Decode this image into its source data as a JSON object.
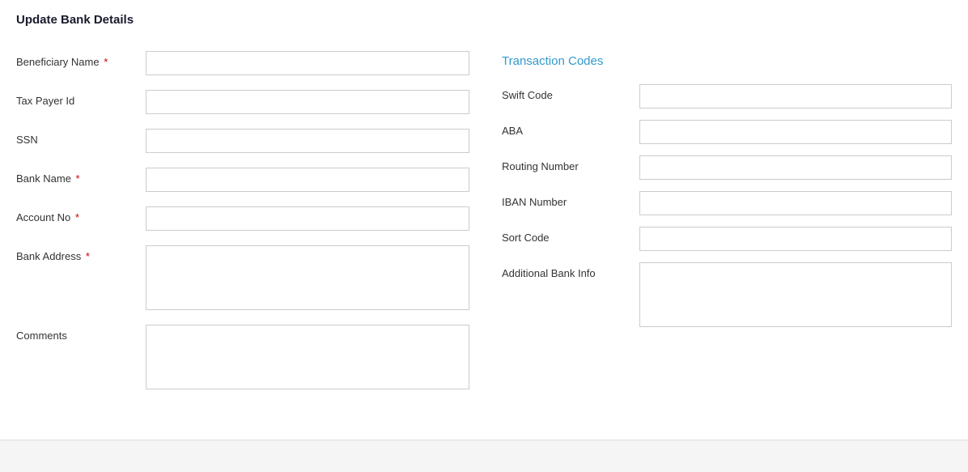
{
  "page": {
    "title": "Update Bank Details"
  },
  "left_form": {
    "fields": [
      {
        "id": "beneficiary-name",
        "label": "Beneficiary Name",
        "required": true,
        "type": "input"
      },
      {
        "id": "tax-payer-id",
        "label": "Tax Payer Id",
        "required": false,
        "type": "input"
      },
      {
        "id": "ssn",
        "label": "SSN",
        "required": false,
        "type": "input"
      },
      {
        "id": "bank-name",
        "label": "Bank Name",
        "required": true,
        "type": "input"
      },
      {
        "id": "account-no",
        "label": "Account No",
        "required": true,
        "type": "input"
      },
      {
        "id": "bank-address",
        "label": "Bank Address",
        "required": true,
        "type": "textarea"
      },
      {
        "id": "comments",
        "label": "Comments",
        "required": false,
        "type": "textarea"
      }
    ]
  },
  "right_section": {
    "title": "Transaction Codes",
    "fields": [
      {
        "id": "swift-code",
        "label": "Swift Code",
        "type": "input"
      },
      {
        "id": "aba",
        "label": "ABA",
        "type": "input"
      },
      {
        "id": "routing-number",
        "label": "Routing Number",
        "type": "input"
      },
      {
        "id": "iban-number",
        "label": "IBAN Number",
        "type": "input"
      },
      {
        "id": "sort-code",
        "label": "Sort Code",
        "type": "input"
      },
      {
        "id": "additional-bank-info",
        "label": "Additional Bank Info",
        "type": "textarea"
      }
    ]
  }
}
